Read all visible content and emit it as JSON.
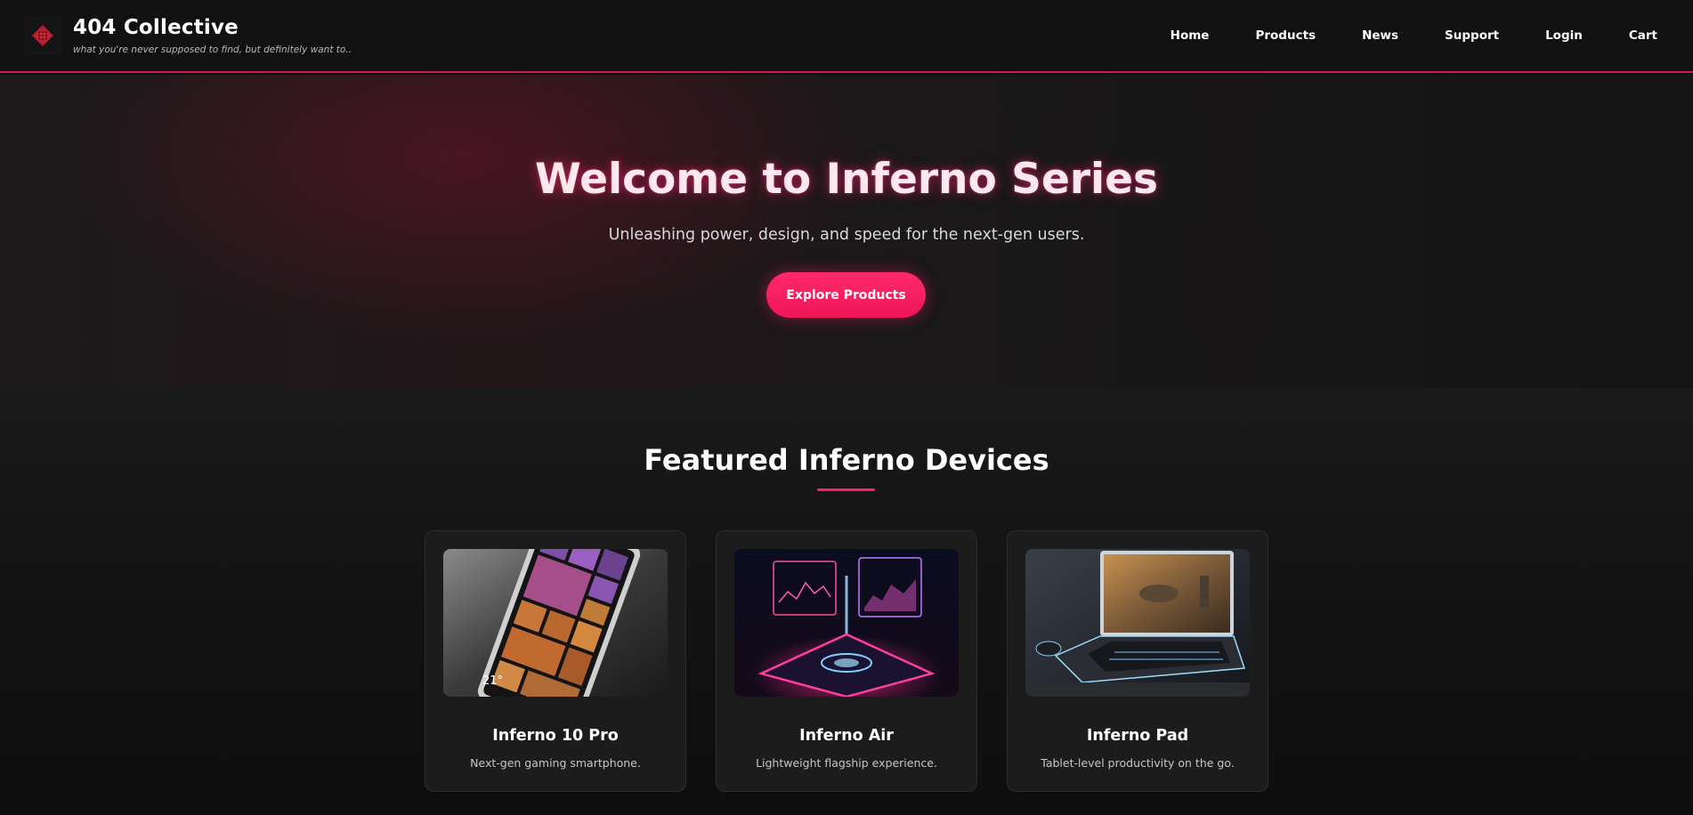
{
  "header": {
    "title": "404 Collective",
    "tagline": "what you're never supposed to find, but definitely want to..",
    "logo_icon": "red-gem-icon",
    "accent_color": "#d4184f",
    "nav": [
      {
        "label": "Home"
      },
      {
        "label": "Products"
      },
      {
        "label": "News"
      },
      {
        "label": "Support"
      },
      {
        "label": "Login"
      },
      {
        "label": "Cart"
      }
    ]
  },
  "hero": {
    "title": "Welcome to Inferno Series",
    "subtitle": "Unleashing power, design, and speed for the next-gen users.",
    "cta_label": "Explore Products",
    "cta_color": "#ff1f64"
  },
  "featured": {
    "title": "Featured Inferno Devices",
    "products": [
      {
        "name": "Inferno 10 Pro",
        "description": "Next-gen gaming smartphone.",
        "image": "smartphone-tiles-image"
      },
      {
        "name": "Inferno Air",
        "description": "Lightweight flagship experience.",
        "image": "holographic-phone-image"
      },
      {
        "name": "Inferno Pad",
        "description": "Tablet-level productivity on the go.",
        "image": "gaming-laptop-image"
      }
    ]
  }
}
